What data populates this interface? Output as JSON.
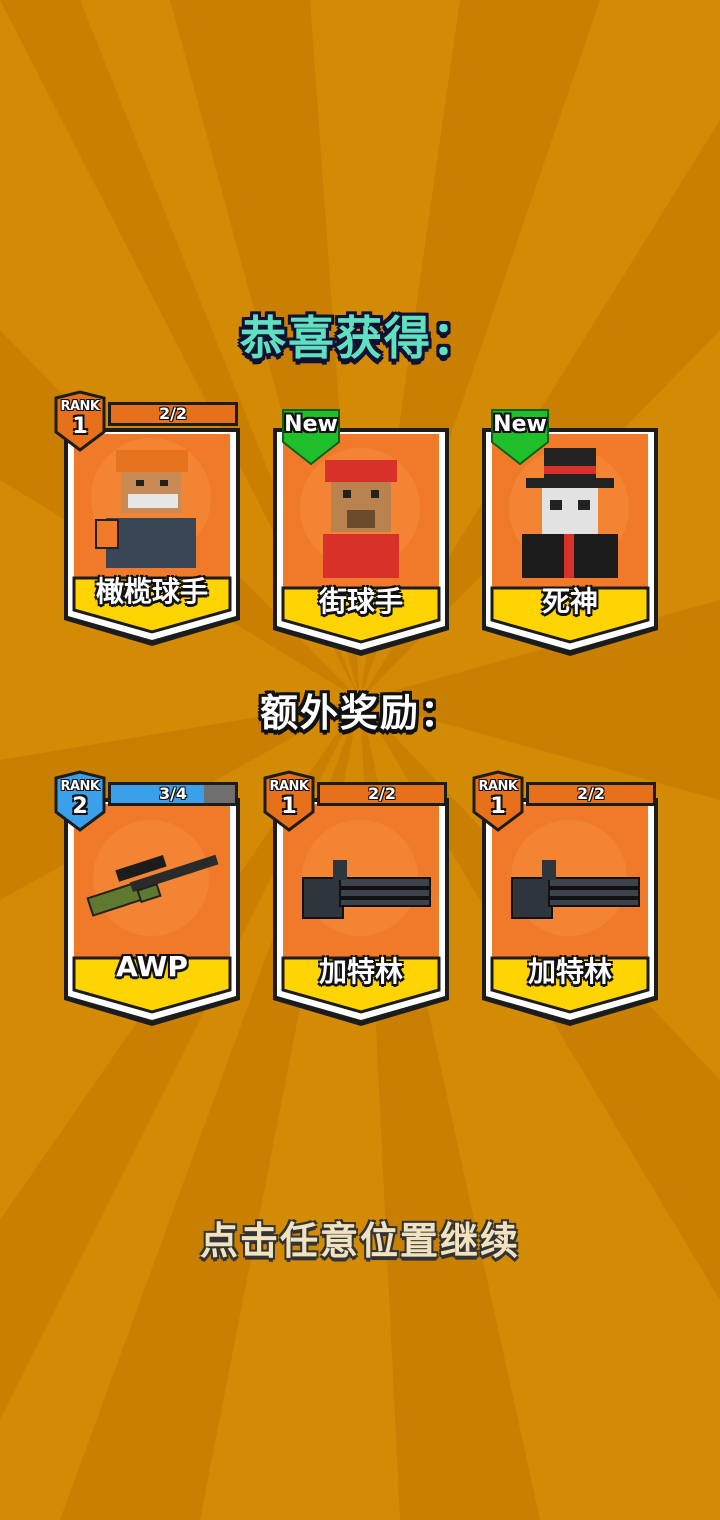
{
  "title": "恭喜获得：",
  "bonus_title": "额外奖励：",
  "continue_text": "点击任意位置继续",
  "colors": {
    "background": "#d38b06",
    "title": "#5fe0bf",
    "card_fill": "#f07a2a",
    "card_label": "#ffd400",
    "new_badge": "#1fbf2b",
    "rank_orange": "#e7701a",
    "rank_blue": "#3aa0ea"
  },
  "rewards": [
    {
      "name": "橄榄球手",
      "icon": "football-player-character",
      "rank_label": "RANK",
      "rank": "1",
      "progress_text": "2/2",
      "progress": 1.0
    },
    {
      "name": "街球手",
      "icon": "street-baller-character",
      "badge": "New"
    },
    {
      "name": "死神",
      "icon": "grim-reaper-character",
      "badge": "New"
    }
  ],
  "bonus_rewards": [
    {
      "name": "AWP",
      "icon": "sniper-rifle-icon",
      "rank_label": "RANK",
      "rank": "2",
      "progress_text": "3/4",
      "progress": 0.75,
      "rank_color": "blue"
    },
    {
      "name": "加特林",
      "icon": "gatling-gun-icon",
      "rank_label": "RANK",
      "rank": "1",
      "progress_text": "2/2",
      "progress": 1.0,
      "rank_color": "orange"
    },
    {
      "name": "加特林",
      "icon": "gatling-gun-icon",
      "rank_label": "RANK",
      "rank": "1",
      "progress_text": "2/2",
      "progress": 1.0,
      "rank_color": "orange"
    }
  ]
}
